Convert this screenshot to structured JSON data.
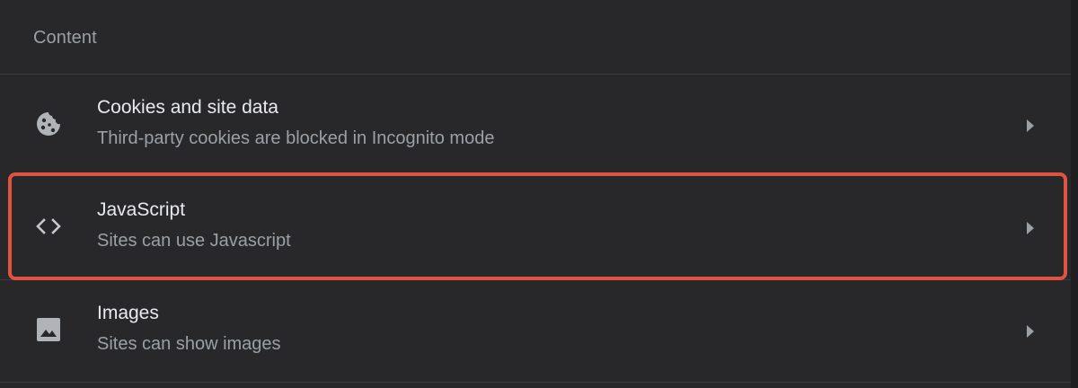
{
  "section": {
    "title": "Content"
  },
  "rows": [
    {
      "icon": "cookie-icon",
      "title": "Cookies and site data",
      "subtitle": "Third-party cookies are blocked in Incognito mode"
    },
    {
      "icon": "code-icon",
      "title": "JavaScript",
      "subtitle": "Sites can use Javascript",
      "highlighted": true
    },
    {
      "icon": "image-icon",
      "title": "Images",
      "subtitle": "Sites can show images"
    }
  ],
  "colors": {
    "background": "#28282b",
    "title_text": "#e8eaed",
    "subtitle_text": "#9aa0a6",
    "highlight_border": "#e0533f"
  }
}
